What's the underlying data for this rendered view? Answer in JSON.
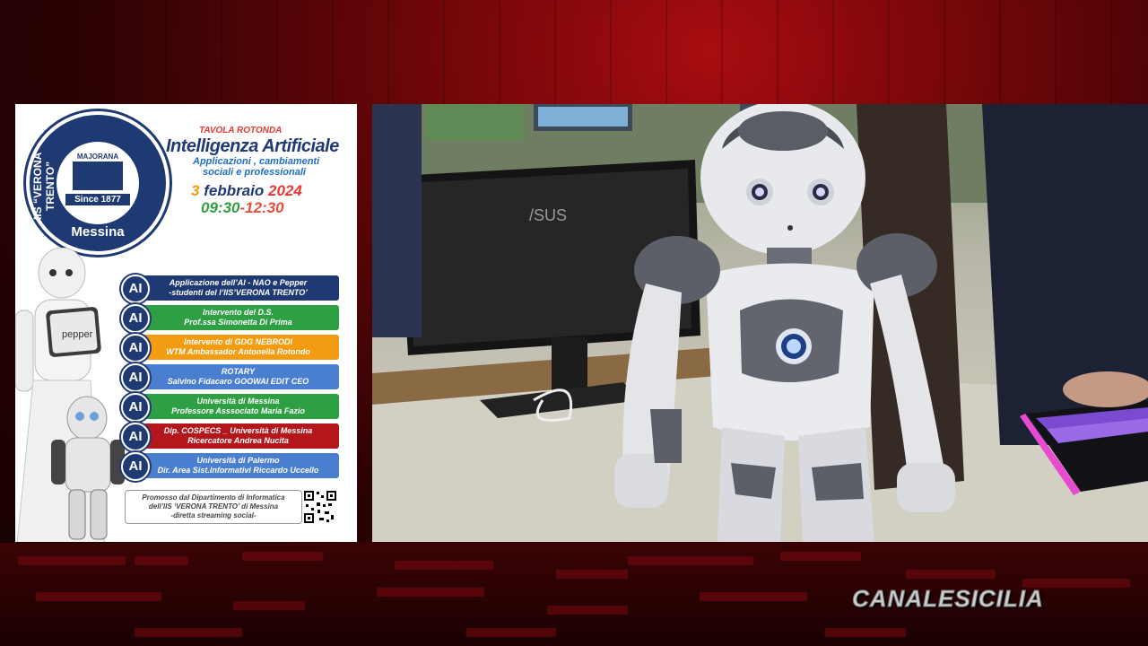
{
  "poster": {
    "logo": {
      "name": "IIS “VERONA TRENTO”",
      "sub": "MAJORANA",
      "since": "Since 1877",
      "city": "Messina"
    },
    "kicker": "TAVOLA ROTONDA",
    "title": "Intelligenza Artificiale",
    "subtitle_line1": "Applicazioni , cambiamenti",
    "subtitle_line2": "sociali e professionali",
    "date_day": "3",
    "date_month": "febbraio",
    "date_year": "2024",
    "time_start": "09:30",
    "time_end": "-12:30",
    "robot_screen_label": "pepper",
    "items": [
      {
        "badge": "AI",
        "line1": "Applicazione dell’AI - NAO e Pepper",
        "line2": "-studenti del l’IIS’VERONA TRENTO’",
        "color": "#1f3a73"
      },
      {
        "badge": "AI",
        "line1": "Intervento del D.S.",
        "line2": "Prof.ssa Simonetta Di Prima",
        "color": "#2ea043"
      },
      {
        "badge": "AI",
        "line1": "Intervento di GDG NEBRODI",
        "line2": "WTM Ambassador Antonella Rotondo",
        "color": "#f39c12"
      },
      {
        "badge": "AI",
        "line1": "ROTARY",
        "line2": "Salvino Fidacaro GOOWAI EDIT CEO",
        "color": "#4a7fd0"
      },
      {
        "badge": "AI",
        "line1": "Università di Messina",
        "line2": "Professore Asssociato Maria Fazio",
        "color": "#2ea043"
      },
      {
        "badge": "AI",
        "line1": "Dip. COSPECS _ Università di Messina",
        "line2": "Ricercatore Andrea Nucita",
        "color": "#b3161b"
      },
      {
        "badge": "AI",
        "line1": "Università di Palermo",
        "line2": "Dir. Area Sist.Informativi  Riccardo Uccello",
        "color": "#4a7fd0"
      }
    ],
    "promo_line1": "Promosso dal Dipartimento di Informatica",
    "promo_line2": "dell’IIS ‘VERONA TRENTO’ di Messina",
    "promo_line3": "-diretta streaming social-"
  },
  "video": {
    "monitor_brand": "/SUS",
    "robot_icon": "nao-robot"
  },
  "channel_logo": "CANALESICILIA"
}
